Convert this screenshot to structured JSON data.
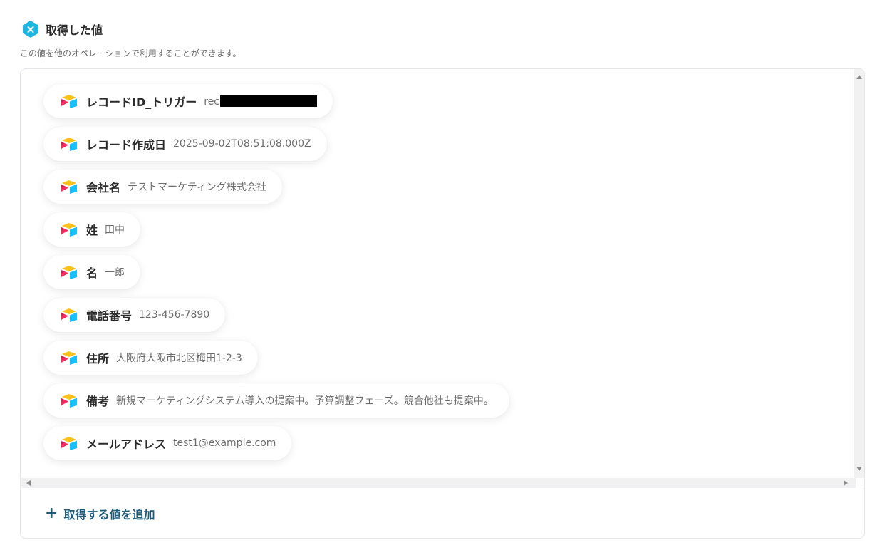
{
  "header": {
    "icon": "x-hexagon-icon",
    "accent_color": "#1cb6e0",
    "title": "取得した値"
  },
  "subtitle": "この値を他のオペレーションで利用することができます。",
  "items": [
    {
      "label": "レコードID_トリガー",
      "value": "rec",
      "redacted": true,
      "icon": "airtable-icon"
    },
    {
      "label": "レコード作成日",
      "value": "2025-09-02T08:51:08.000Z",
      "icon": "airtable-icon"
    },
    {
      "label": "会社名",
      "value": "テストマーケティング株式会社",
      "icon": "airtable-icon"
    },
    {
      "label": "姓",
      "value": "田中",
      "icon": "airtable-icon"
    },
    {
      "label": "名",
      "value": "一郎",
      "icon": "airtable-icon"
    },
    {
      "label": "電話番号",
      "value": "123-456-7890",
      "icon": "airtable-icon"
    },
    {
      "label": "住所",
      "value": "大阪府大阪市北区梅田1-2-3",
      "icon": "airtable-icon"
    },
    {
      "label": "備考",
      "value": "新規マーケティングシステム導入の提案中。予算調整フェーズ。競合他社も提案中。",
      "icon": "airtable-icon"
    },
    {
      "label": "メールアドレス",
      "value": "test1@example.com",
      "icon": "airtable-icon"
    }
  ],
  "footer": {
    "add_label": "取得する値を追加",
    "add_icon": "plus-icon",
    "link_color": "#1e5a7a"
  }
}
